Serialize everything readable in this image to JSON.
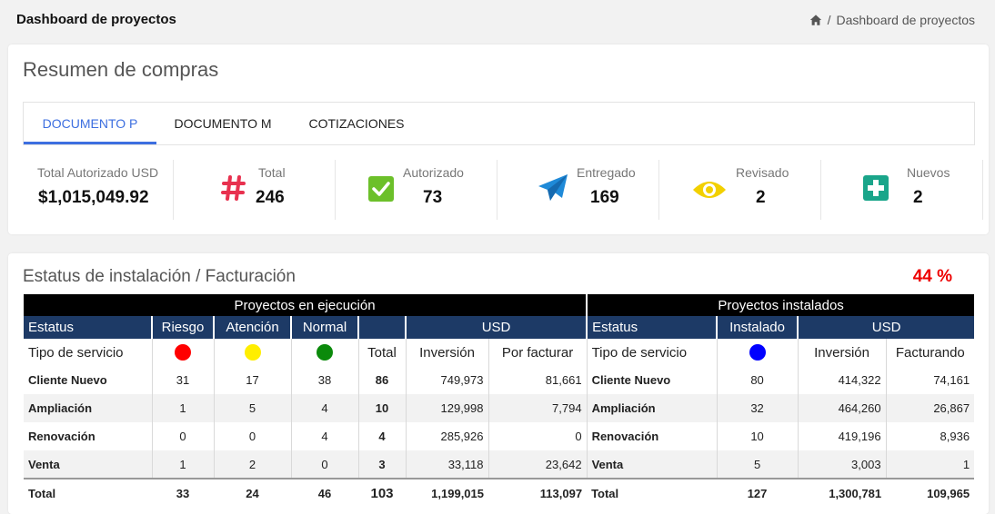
{
  "header": {
    "title": "Dashboard de proyectos",
    "breadcrumb_sep": "/",
    "breadcrumb_current": "Dashboard de proyectos"
  },
  "compras": {
    "title": "Resumen de compras",
    "tabs": [
      {
        "label": "DOCUMENTO P",
        "active": true
      },
      {
        "label": "DOCUMENTO M",
        "active": false
      },
      {
        "label": "COTIZACIONES",
        "active": false
      }
    ],
    "stats": [
      {
        "label": "Total Autorizado USD",
        "value": "$1,015,049.92",
        "icon": "none"
      },
      {
        "label": "Total",
        "value": "246",
        "icon": "hash-icon",
        "color": "#e8314f"
      },
      {
        "label": "Autorizado",
        "value": "73",
        "icon": "check-square-icon",
        "color": "#6cc02a"
      },
      {
        "label": "Entregado",
        "value": "169",
        "icon": "paper-plane-icon",
        "color": "#1f8ad8"
      },
      {
        "label": "Revisado",
        "value": "2",
        "icon": "eye-icon",
        "color": "#f2d000"
      },
      {
        "label": "Nuevos",
        "value": "2",
        "icon": "plus-square-icon",
        "color": "#1aa58a"
      }
    ]
  },
  "estatus": {
    "title": "Estatus de instalación / Facturación",
    "percent": "44 %",
    "group_left": "Proyectos en ejecución",
    "group_right": "Proyectos instalados",
    "hdr": {
      "estatus": "Estatus",
      "riesgo": "Riesgo",
      "atencion": "Atención",
      "normal": "Normal",
      "usd": "USD",
      "estatus2": "Estatus",
      "instalado": "Instalado",
      "usd2": "USD"
    },
    "sub": {
      "tipo": "Tipo de servicio",
      "total": "Total",
      "inversion": "Inversión",
      "por_facturar": "Por facturar",
      "tipo2": "Tipo de servicio",
      "inversion2": "Inversión",
      "facturando": "Facturando"
    },
    "dots": {
      "riesgo": "#ff0000",
      "atencion": "#ffee00",
      "normal": "#0b8a0b",
      "instalado": "#0000ff"
    },
    "rows": [
      {
        "tipo": "Cliente Nuevo",
        "riesgo": "31",
        "atencion": "17",
        "normal": "38",
        "total": "86",
        "inversion": "749,973",
        "por_facturar": "81,661",
        "tipo2": "Cliente Nuevo",
        "instalado": "80",
        "inversion2": "414,322",
        "facturando": "74,161"
      },
      {
        "tipo": "Ampliación",
        "riesgo": "1",
        "atencion": "5",
        "normal": "4",
        "total": "10",
        "inversion": "129,998",
        "por_facturar": "7,794",
        "tipo2": "Ampliación",
        "instalado": "32",
        "inversion2": "464,260",
        "facturando": "26,867"
      },
      {
        "tipo": "Renovación",
        "riesgo": "0",
        "atencion": "0",
        "normal": "4",
        "total": "4",
        "inversion": "285,926",
        "por_facturar": "0",
        "tipo2": "Renovación",
        "instalado": "10",
        "inversion2": "419,196",
        "facturando": "8,936"
      },
      {
        "tipo": "Venta",
        "riesgo": "1",
        "atencion": "2",
        "normal": "0",
        "total": "3",
        "inversion": "33,118",
        "por_facturar": "23,642",
        "tipo2": "Venta",
        "instalado": "5",
        "inversion2": "3,003",
        "facturando": "1"
      }
    ],
    "totals": {
      "tipo": "Total",
      "riesgo": "33",
      "atencion": "24",
      "normal": "46",
      "total": "103",
      "inversion": "1,199,015",
      "por_facturar": "113,097",
      "tipo2": "Total",
      "instalado": "127",
      "inversion2": "1,300,781",
      "facturando": "109,965"
    }
  }
}
